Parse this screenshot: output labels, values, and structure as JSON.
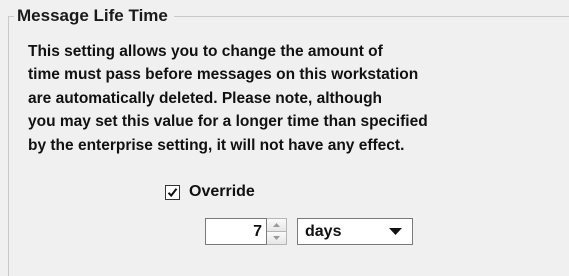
{
  "group": {
    "title": "Message Life Time"
  },
  "description": {
    "lines": [
      "This setting allows you to change the amount of",
      "time must pass before messages on this workstation",
      "are automatically deleted.  Please note, although",
      "you may set this value for a longer time than specified",
      "by the enterprise setting, it will not have any effect."
    ]
  },
  "override": {
    "label": "Override",
    "checked": true
  },
  "lifetime": {
    "value": "7",
    "unit": "days",
    "up_icon": "spin-up-arrow-icon",
    "down_icon": "spin-down-arrow-icon",
    "dropdown_icon": "chevron-down-icon"
  }
}
